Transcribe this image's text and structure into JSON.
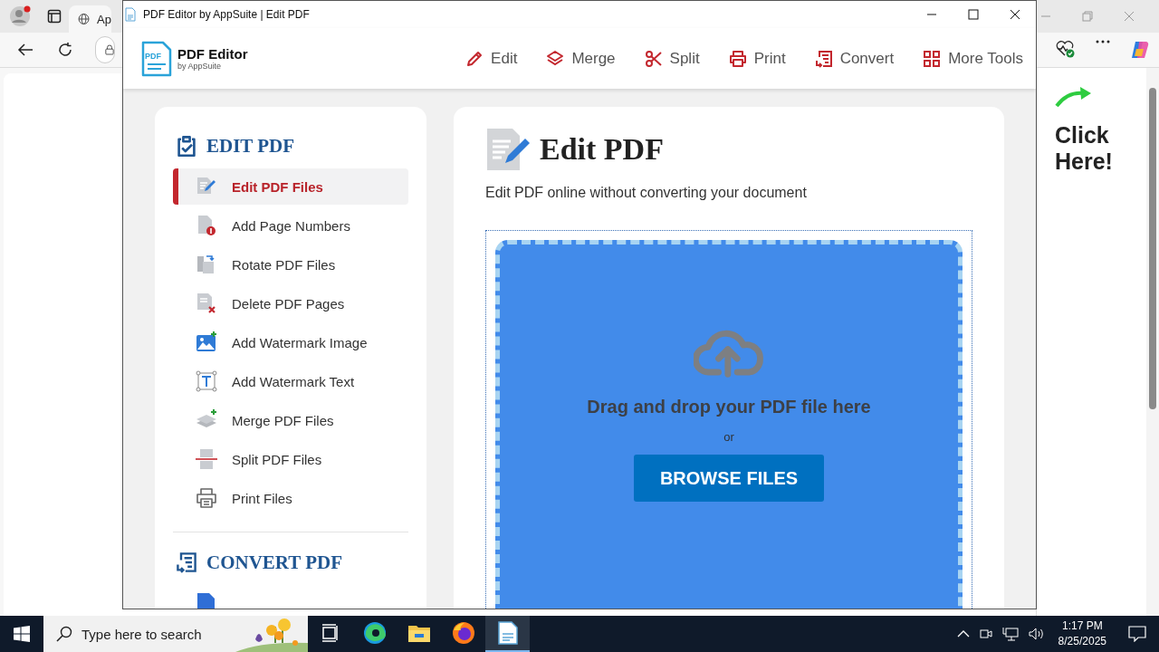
{
  "browser": {
    "tab_title": "Ap",
    "ad_text": "Click Here!"
  },
  "window": {
    "title": "PDF Editor by AppSuite | Edit PDF"
  },
  "header": {
    "logo_badge": "PDF",
    "logo_title": "PDF Editor",
    "logo_subtitle": "by AppSuite",
    "nav": [
      {
        "label": "Edit"
      },
      {
        "label": "Merge"
      },
      {
        "label": "Split"
      },
      {
        "label": "Print"
      },
      {
        "label": "Convert"
      },
      {
        "label": "More Tools"
      }
    ]
  },
  "sidebar": {
    "sections": [
      {
        "title": "EDIT PDF",
        "items": [
          {
            "label": "Edit PDF Files",
            "selected": true
          },
          {
            "label": "Add Page Numbers",
            "selected": false
          },
          {
            "label": "Rotate PDF Files",
            "selected": false
          },
          {
            "label": "Delete PDF Pages",
            "selected": false
          },
          {
            "label": "Add Watermark Image",
            "selected": false
          },
          {
            "label": "Add Watermark Text",
            "selected": false
          },
          {
            "label": "Merge PDF Files",
            "selected": false
          },
          {
            "label": "Split PDF Files",
            "selected": false
          },
          {
            "label": "Print Files",
            "selected": false
          }
        ]
      },
      {
        "title": "CONVERT PDF",
        "items": [
          {
            "selected": false
          }
        ]
      }
    ]
  },
  "page": {
    "title": "Edit PDF",
    "subtitle": "Edit PDF online without converting your document",
    "upload": {
      "prompt": "Drag and drop your PDF file here",
      "separator": "or",
      "button": "BROWSE FILES"
    }
  },
  "taskbar": {
    "search_placeholder": "Type here to search",
    "time": "1:17 PM",
    "date": "8/25/2025",
    "apps": [
      {
        "kind": "task-view",
        "selected": false
      },
      {
        "kind": "edge",
        "selected": false
      },
      {
        "kind": "folder",
        "selected": false
      },
      {
        "kind": "firefox",
        "selected": false
      },
      {
        "kind": "pdf-editor",
        "selected": true
      }
    ]
  }
}
